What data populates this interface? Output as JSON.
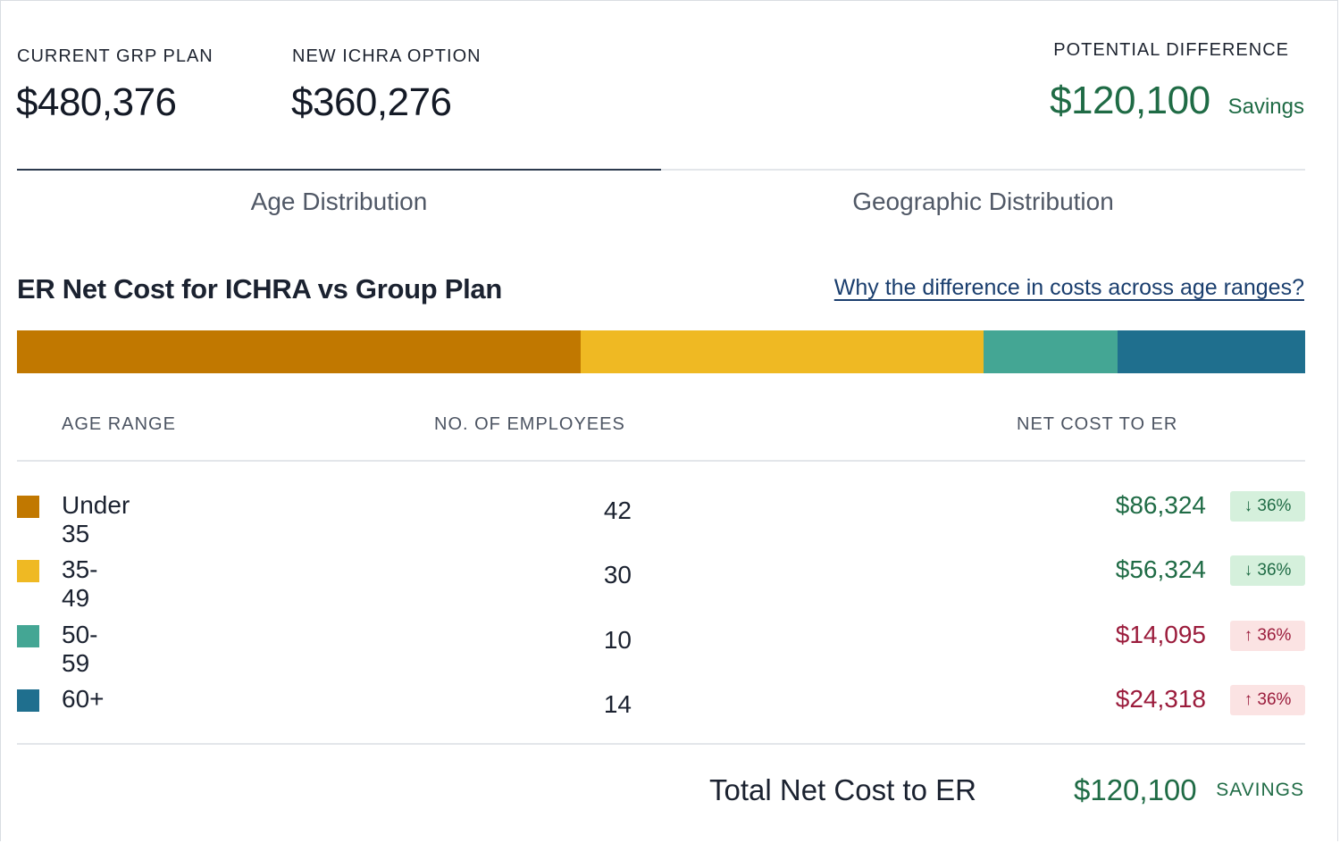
{
  "summary": {
    "current": {
      "label": "CURRENT GRP PLAN",
      "value": "$480,376"
    },
    "new_option": {
      "label": "NEW ICHRA OPTION",
      "value": "$360,276"
    },
    "difference": {
      "label": "POTENTIAL DIFFERENCE",
      "value": "$120,100",
      "note": "Savings"
    }
  },
  "tabs": [
    {
      "label": "Age Distribution",
      "active": true
    },
    {
      "label": "Geographic Distribution",
      "active": false
    }
  ],
  "section": {
    "title": "ER Net Cost for ICHRA vs Group Plan",
    "help_link": "Why the difference in costs across age ranges?"
  },
  "colors": {
    "under_35": "#c17800",
    "35_49": "#efb923",
    "50_59": "#44a694",
    "60_plus": "#1f6f8e",
    "savings_green": "#1f6b45",
    "cost_red": "#9b1c3c"
  },
  "table": {
    "headers": {
      "age_range": "AGE RANGE",
      "employees": "NO. OF EMPLOYEES",
      "net_cost": "NET COST TO ER"
    },
    "rows": [
      {
        "age": "Under 35",
        "employees": "42",
        "cost": "$86,324",
        "change": "36%",
        "direction": "down",
        "color": "#c17800"
      },
      {
        "age": "35-49",
        "employees": "30",
        "cost": "$56,324",
        "change": "36%",
        "direction": "down",
        "color": "#efb923"
      },
      {
        "age": "50-59",
        "employees": "10",
        "cost": "$14,095",
        "change": "36%",
        "direction": "up",
        "color": "#44a694"
      },
      {
        "age": "60+",
        "employees": "14",
        "cost": "$24,318",
        "change": "36%",
        "direction": "up",
        "color": "#1f6f8e"
      }
    ]
  },
  "total": {
    "label": "Total Net Cost to ER",
    "value": "$120,100",
    "note": "SAVINGS"
  },
  "chart_data": {
    "type": "bar",
    "categories": [
      "Under 35",
      "35-49",
      "50-59",
      "60+"
    ],
    "values": [
      42,
      30,
      10,
      14
    ]
  }
}
